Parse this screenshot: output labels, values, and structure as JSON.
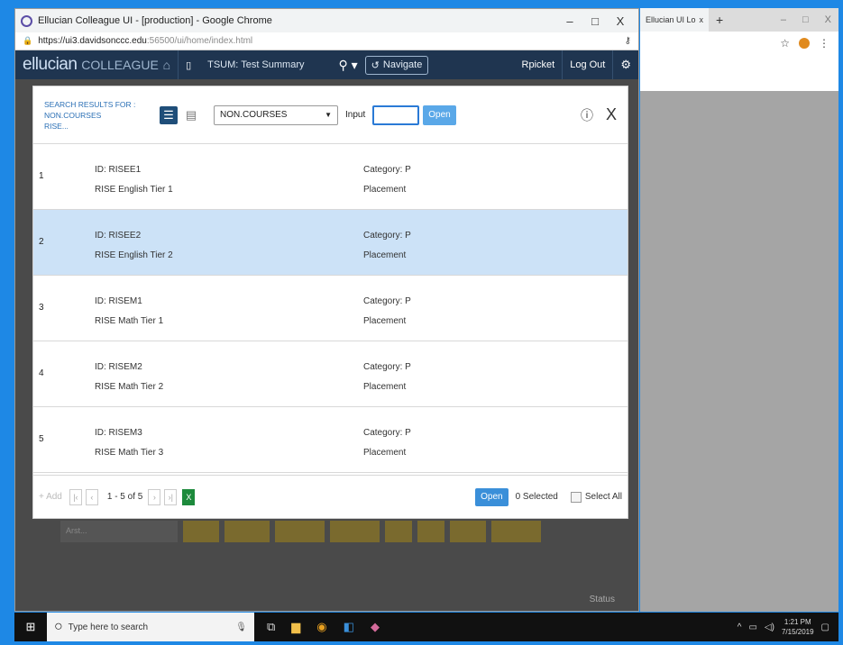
{
  "window": {
    "title": "Ellucian Colleague UI - [production] - Google Chrome",
    "url_host": "https://ui3.davidsonccc.edu",
    "url_rest": ":56500/ui/home/index.html",
    "min": "–",
    "max": "□",
    "close": "X"
  },
  "header": {
    "brand": "ellucian",
    "brand_sub": "COLLEAGUE",
    "form_name": "TSUM: Test Summary",
    "navigate": "Navigate",
    "user": "Rpicket",
    "logout": "Log Out"
  },
  "modal": {
    "search_label_line1": "SEARCH RESULTS FOR :",
    "search_label_line2": "NON.COURSES",
    "search_label_line3": "RISE...",
    "select_value": "NON.COURSES",
    "input_label": "Input",
    "open_label": "Open",
    "help": "?",
    "close": "X",
    "rows": [
      {
        "num": "1",
        "id": "ID: RISEE1",
        "desc": "RISE English Tier 1",
        "cat": "Category: P",
        "type": "Placement"
      },
      {
        "num": "2",
        "id": "ID: RISEE2",
        "desc": "RISE English Tier 2",
        "cat": "Category: P",
        "type": "Placement"
      },
      {
        "num": "3",
        "id": "ID: RISEM1",
        "desc": "RISE Math Tier 1",
        "cat": "Category: P",
        "type": "Placement"
      },
      {
        "num": "4",
        "id": "ID: RISEM2",
        "desc": "RISE Math Tier 2",
        "cat": "Category: P",
        "type": "Placement"
      },
      {
        "num": "5",
        "id": "ID: RISEM3",
        "desc": "RISE Math Tier 3",
        "cat": "Category: P",
        "type": "Placement"
      }
    ],
    "footer": {
      "add": "+ Add",
      "page_text": "1 - 5 of 5",
      "open": "Open",
      "selected": "0 Selected",
      "select_all": "Select All"
    }
  },
  "background": {
    "status": "Status",
    "cell_text": "Arst..."
  },
  "window2": {
    "tab_title": "Ellucian UI Lo",
    "tab_close": "x",
    "plus": "+",
    "min": "–",
    "max": "□",
    "close": "X"
  },
  "taskbar": {
    "search_placeholder": "Type here to search",
    "time": "1:21 PM",
    "date": "7/15/2019"
  },
  "colors": {
    "accent": "#1f4e79",
    "header_bg": "#1f3550",
    "selected_row": "#cce2f7",
    "open_button": "#5aa8e8"
  }
}
